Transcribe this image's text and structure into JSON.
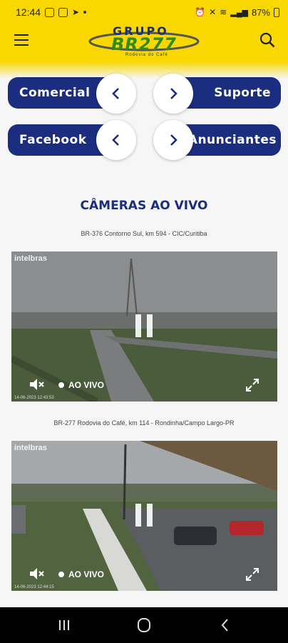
{
  "status_bar": {
    "time": "12:44",
    "battery": "87%"
  },
  "header": {
    "logo_grupo": "GRUPO",
    "logo_br": "BR277",
    "logo_tagline": "Rodovia do Café"
  },
  "buttons": {
    "comercial": "Comercial",
    "suporte": "Suporte",
    "facebook": "Facebook",
    "anunciantes": "Anunciantes"
  },
  "section": {
    "title": "CÂMERAS AO VIVO"
  },
  "cameras": [
    {
      "caption": "BR-376 Contorno Sul, km 594 - CIC/Curitiba",
      "watermark": "intelbras",
      "live_label": "AO VIVO",
      "timestamp": "14-06-2023 12:43:53"
    },
    {
      "caption": "BR-277 Rodovia do Café, km 114 - Rondinha/Campo Largo-PR",
      "watermark": "intelbras",
      "live_label": "AO VIVO",
      "timestamp": "14-06-2023 12:44:15"
    }
  ],
  "icons": {
    "menu": "hamburger-icon",
    "search": "search-icon",
    "back": "chevron-left-icon",
    "forward": "chevron-right-icon",
    "mute": "mute-icon",
    "fullscreen": "fullscreen-icon",
    "nav_recents": "recents-icon",
    "nav_home": "home-icon",
    "nav_back": "back-icon"
  },
  "colors": {
    "brand_yellow": "#f8d800",
    "brand_blue": "#1b2d7e",
    "brand_green": "#2e8b22"
  }
}
